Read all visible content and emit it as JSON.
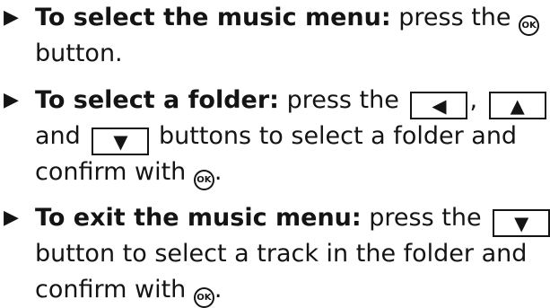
{
  "bullet_glyph": "▶",
  "instructions": [
    {
      "heading": "To select the music menu:",
      "line1": "press the",
      "line2": "button."
    },
    {
      "heading": "To select a folder:",
      "line1": "press the",
      "sep1": ",",
      "line2_start": "and",
      "line2_end": "buttons to select a folder and",
      "line3": "confirm with",
      "line3_end": "."
    },
    {
      "heading": "To exit the music menu:",
      "line1": "press the",
      "line2": "button to select a track in the folder and",
      "line3": "confirm with",
      "line3_end": "."
    }
  ],
  "icons": {
    "ok_label": "OK",
    "left_arrow": "◀",
    "up_arrow": "▲",
    "down_arrow": "▼"
  }
}
